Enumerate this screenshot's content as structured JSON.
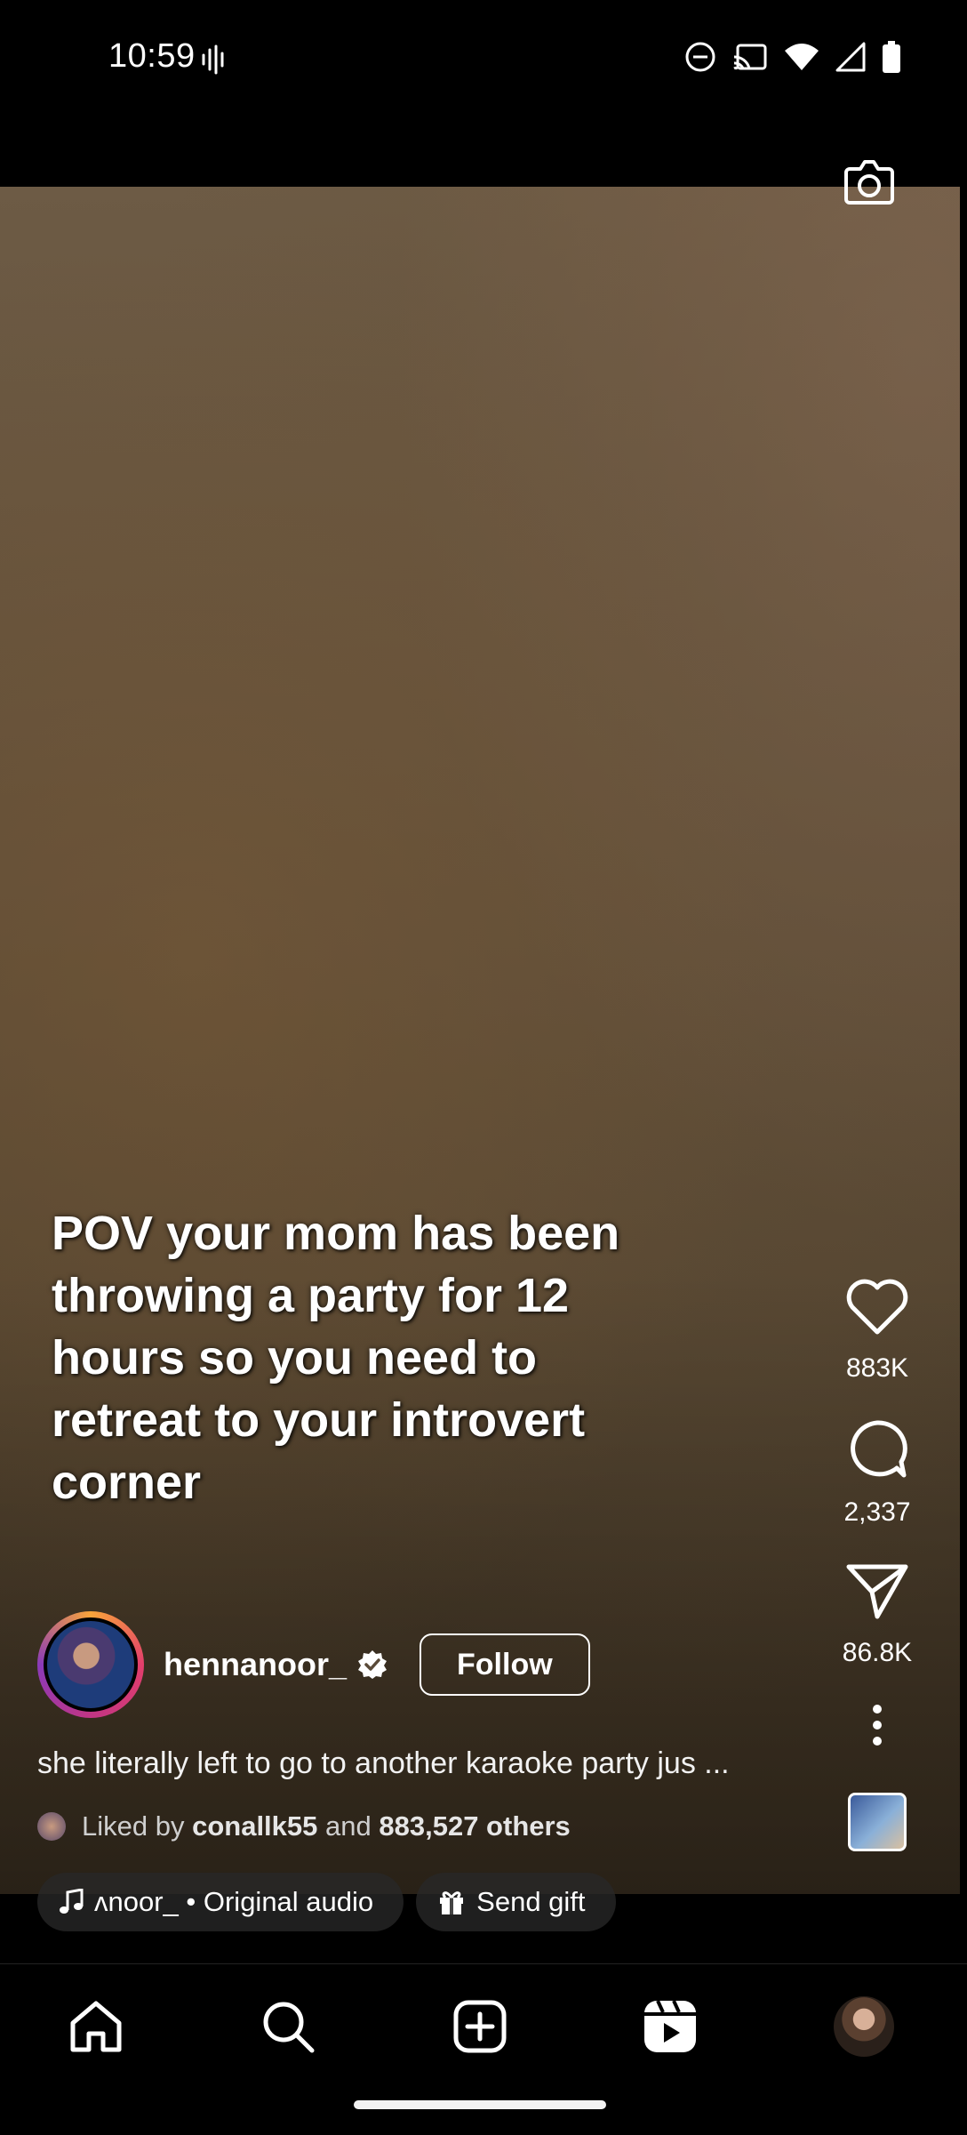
{
  "status_bar": {
    "time": "10:59",
    "left_icons": [
      "voice-activity-icon"
    ],
    "right_icons": [
      "do-not-disturb-icon",
      "cast-icon",
      "wifi-icon",
      "cell-signal-icon",
      "battery-icon"
    ]
  },
  "reel": {
    "caption_overlay": "POV your mom has been throwing a party for 12 hours so you need to retreat to your introvert corner",
    "author": {
      "username": "hennanoor_",
      "verified": true,
      "follow_label": "Follow"
    },
    "description": "she literally left to go to another karaoke party jus ...",
    "likes": {
      "prefix": "Liked by",
      "user": "conallk55",
      "and": "and",
      "others": "883,527 others"
    },
    "chips": {
      "audio_label": "ʌnoor_ • Original audio",
      "gift_label": "Send gift"
    }
  },
  "actions": {
    "like_count": "883K",
    "comment_count": "2,337",
    "share_count": "86.8K"
  },
  "nav": {
    "items": [
      "home",
      "search",
      "create",
      "reels",
      "profile"
    ]
  },
  "colors": {
    "background": "#000000",
    "text": "#ffffff",
    "ring_gradient": [
      "#f9a43a",
      "#e23e6c",
      "#c13584",
      "#8a3ab9"
    ]
  }
}
